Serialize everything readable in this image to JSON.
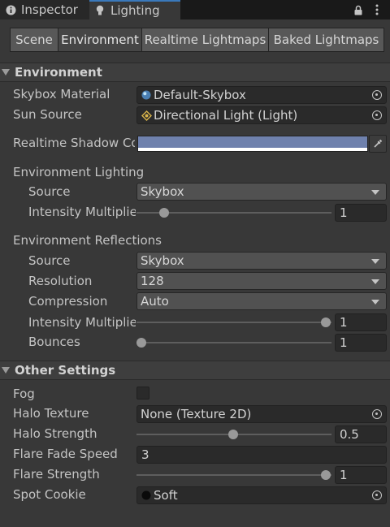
{
  "tabs": {
    "inspector": "Inspector",
    "lighting": "Lighting"
  },
  "toolbar": {
    "scene": "Scene",
    "environment": "Environment",
    "realtime": "Realtime Lightmaps",
    "baked": "Baked Lightmaps",
    "selected": "Environment"
  },
  "environment": {
    "header": "Environment",
    "skybox_material_label": "Skybox Material",
    "skybox_material_value": "Default-Skybox",
    "sun_source_label": "Sun Source",
    "sun_source_value": "Directional Light (Light)",
    "realtime_shadow_label": "Realtime Shadow Co",
    "realtime_shadow_color": "#6f81ad",
    "lighting_header": "Environment Lighting",
    "lighting_source_label": "Source",
    "lighting_source_value": "Skybox",
    "lighting_intensity_label": "Intensity Multiplie",
    "lighting_intensity_value": "1",
    "reflections_header": "Environment Reflections",
    "refl_source_label": "Source",
    "refl_source_value": "Skybox",
    "resolution_label": "Resolution",
    "resolution_value": "128",
    "compression_label": "Compression",
    "compression_value": "Auto",
    "refl_intensity_label": "Intensity Multiplie",
    "refl_intensity_value": "1",
    "bounces_label": "Bounces",
    "bounces_value": "1"
  },
  "other": {
    "header": "Other Settings",
    "fog_label": "Fog",
    "fog_checked": false,
    "halo_texture_label": "Halo Texture",
    "halo_texture_value": "None (Texture 2D)",
    "halo_strength_label": "Halo Strength",
    "halo_strength_value": "0.5",
    "flare_fade_label": "Flare Fade Speed",
    "flare_fade_value": "3",
    "flare_strength_label": "Flare Strength",
    "flare_strength_value": "1",
    "spot_cookie_label": "Spot Cookie",
    "spot_cookie_value": "Soft"
  },
  "colors": {
    "accent": "#3a79bb",
    "background": "#383838"
  }
}
